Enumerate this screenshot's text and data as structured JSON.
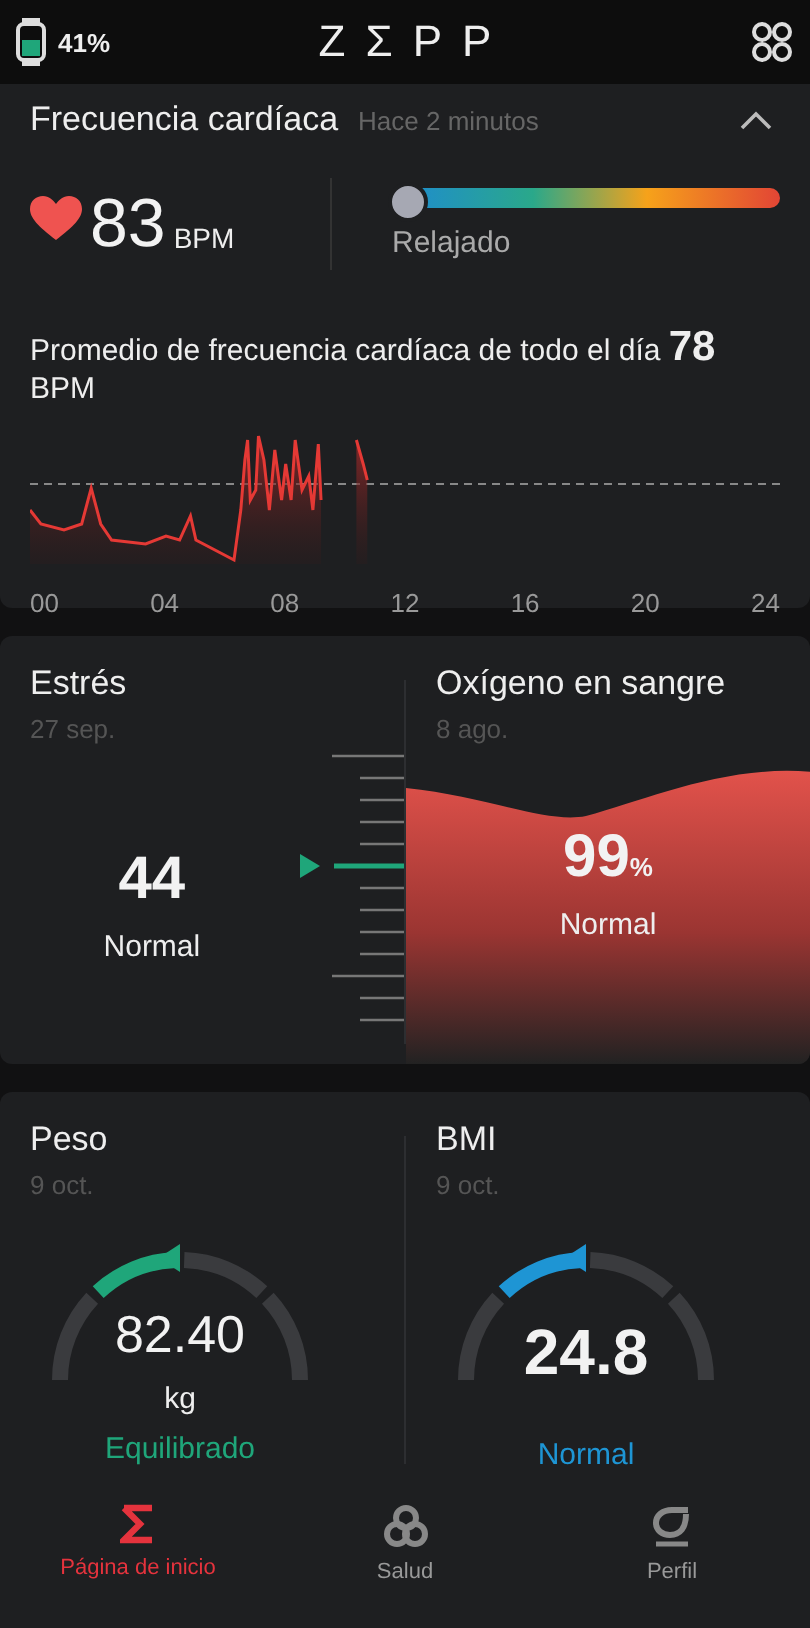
{
  "header": {
    "battery": "41%",
    "logo": "ZΣPP"
  },
  "heart_rate": {
    "title": "Frecuencia cardíaca",
    "time": "Hace 2 minutos",
    "expanded": true,
    "value": "83",
    "unit": "BPM",
    "zone": {
      "level": 0.02,
      "label": "Relajado"
    },
    "average": "Promedio de frecuencia cardíaca de todo el día **78** BPM",
    "x_labels": [
      "00",
      "04",
      "08",
      "12",
      "16",
      "20",
      "24"
    ]
  },
  "stress": {
    "title": "Estrés",
    "date": "27 sep.",
    "value": "44",
    "status": "Normal"
  },
  "oxygen": {
    "title": "Oxígeno en sangre",
    "date": "8 ago.",
    "value": "99",
    "unit": "%",
    "status": "Normal"
  },
  "gauges": [
    {
      "title": "Peso",
      "date": "9 oct.",
      "value": "82.40",
      "unit": "kg",
      "status": "Equilibrado",
      "color": "#1fa67a",
      "segments": [
        {
          "selected": false
        },
        {
          "selected": true
        },
        {
          "selected": false
        },
        {
          "selected": false
        }
      ]
    },
    {
      "title": "BMI",
      "date": "9 oct.",
      "value": "24.8",
      "status": "Normal",
      "color": "#1e95d4",
      "segments": [
        {
          "selected": false
        },
        {
          "selected": true
        },
        {
          "selected": false
        },
        {
          "selected": false
        }
      ]
    }
  ],
  "nav": [
    {
      "kind": "home",
      "label": "Página de inicio",
      "selected": true
    },
    {
      "kind": "health",
      "label": "Salud",
      "selected": false
    },
    {
      "kind": "profile",
      "label": "Perfil",
      "selected": false
    }
  ]
}
